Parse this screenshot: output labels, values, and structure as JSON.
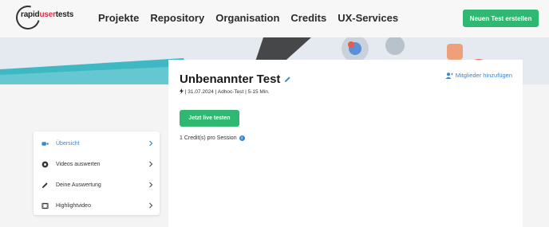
{
  "header": {
    "logo": {
      "part1": "rapid",
      "part2": "user",
      "part3": "tests"
    },
    "nav": [
      "Projekte",
      "Repository",
      "Organisation",
      "Credits",
      "UX-Services"
    ],
    "new_test_button": "Neuen Test erstellen"
  },
  "test": {
    "title": "Unbenannter Test",
    "meta": "| 31.07.2024 | Adhoc-Test | 5-15 Min.",
    "add_members": "Mitglieder hinzufügen",
    "live_button": "Jetzt live testen",
    "credits": "1 Credit(s) pro Session"
  },
  "sidebar": {
    "items": [
      {
        "label": "Übersicht",
        "icon": "video-camera-icon",
        "active": true
      },
      {
        "label": "Videos auswerten",
        "icon": "record-icon",
        "active": false
      },
      {
        "label": "Deine Auswertung",
        "icon": "pencil-icon",
        "active": false
      },
      {
        "label": "Highlightvideo",
        "icon": "film-icon",
        "active": false
      }
    ]
  },
  "colors": {
    "accent_green": "#2eb872",
    "link_blue": "#3f86c7",
    "brand_red": "#d9304f",
    "banner_teal": "#3fb8c4"
  }
}
